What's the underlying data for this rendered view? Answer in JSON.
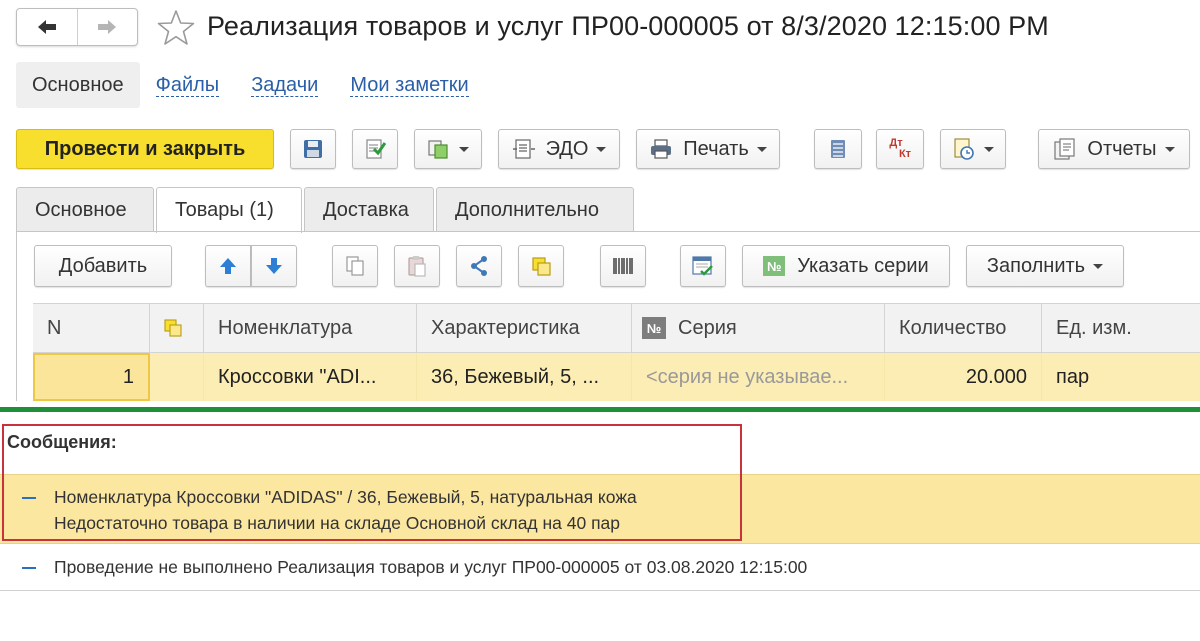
{
  "header": {
    "title": "Реализация товаров и услуг ПР00-000005 от 8/3/2020 12:15:00 PM"
  },
  "form_tabs": [
    {
      "label": "Основное"
    },
    {
      "label": "Файлы"
    },
    {
      "label": "Задачи"
    },
    {
      "label": "Мои заметки"
    }
  ],
  "toolbar": {
    "post_close": "Провести и закрыть",
    "edo": "ЭДО",
    "print": "Печать",
    "reports": "Отчеты",
    "dt_kt_top": "Дт",
    "dt_kt_bottom": "Кт"
  },
  "inner_tabs": [
    {
      "label": "Основное"
    },
    {
      "label": "Товары (1)"
    },
    {
      "label": "Доставка"
    },
    {
      "label": "Дополнительно"
    }
  ],
  "table_toolbar": {
    "add": "Добавить",
    "series_icon": "№",
    "set_series": "Указать серии",
    "fill": "Заполнить"
  },
  "table": {
    "columns": [
      "N",
      "",
      "Номенклатура",
      "Характеристика",
      "Серия",
      "Количество",
      "Ед. изм."
    ],
    "series_icon": "№",
    "rows": [
      {
        "n": "1",
        "nomenclature": "Кроссовки \"ADI...",
        "characteristic": "36, Бежевый, 5, ...",
        "series": "<серия не указывае...",
        "quantity": "20.000",
        "unit": "пар"
      }
    ]
  },
  "messages": {
    "title": "Сообщения:",
    "items": [
      {
        "line1": "Номенклатура Кроссовки \"ADIDAS\" / 36, Бежевый, 5, натуральная кожа",
        "line2": "Недостаточно товара в наличии на складе Основной склад на 40 пар"
      },
      {
        "line1": "Проведение не выполнено Реализация товаров и услуг ПР00-000005 от 03.08.2020 12:15:00"
      }
    ]
  },
  "colors": {
    "primary_button": "#f8df2d",
    "selected_row": "#fbedb3",
    "message_highlight": "#fbe79f",
    "separator": "#1f8f3a",
    "frame": "#c8323a",
    "link": "#2a5fa8"
  }
}
